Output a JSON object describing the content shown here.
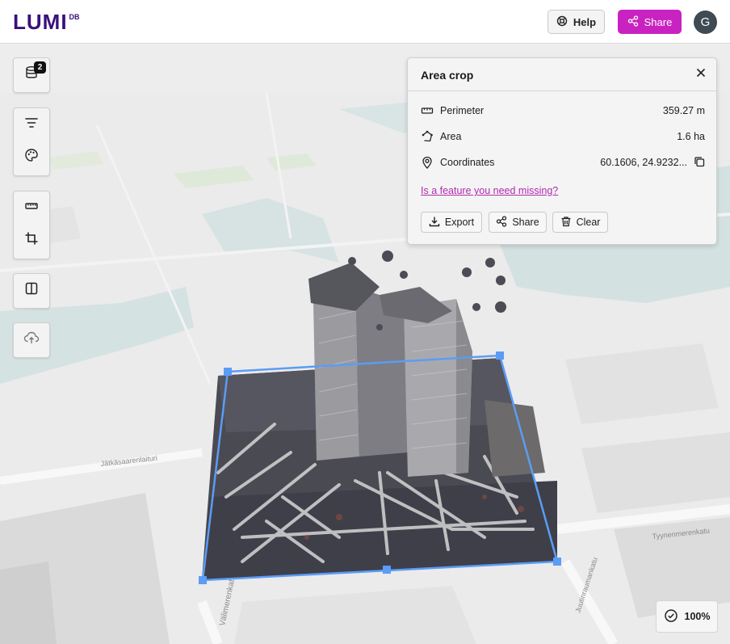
{
  "header": {
    "logo_text": "LUMI",
    "logo_sup": "DB",
    "help_label": "Help",
    "share_label": "Share",
    "avatar_initial": "G"
  },
  "toolbar": {
    "datasets_badge": "2",
    "icons": [
      "database-icon",
      "filter-icon",
      "palette-icon",
      "ruler-icon",
      "crop-icon",
      "split-view-icon",
      "cloud-upload-icon"
    ]
  },
  "map": {
    "street_labels": [
      "Jätkäsaarenlaituri",
      "Tyynenmerenkatu",
      "Välimerenkatu",
      "Juutinraumankatu"
    ]
  },
  "panel": {
    "title": "Area crop",
    "perimeter_label": "Perimeter",
    "perimeter_value": "359.27 m",
    "area_label": "Area",
    "area_value": "1.6 ha",
    "coordinates_label": "Coordinates",
    "coordinates_value": "60.1606, 24.9232...",
    "missing_link": "Is a feature you need missing?",
    "export_label": "Export",
    "share_label": "Share",
    "clear_label": "Clear"
  },
  "status": {
    "progress_text": "100%",
    "progress": 100
  },
  "colors": {
    "brand_purple": "#3a0f7d",
    "accent_magenta": "#c823c0",
    "crop_outline": "#5b9cf5",
    "water": "#d5e2e2"
  }
}
